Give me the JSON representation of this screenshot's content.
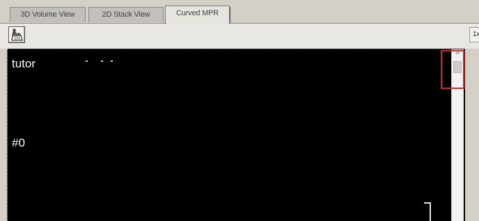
{
  "tabs": [
    {
      "label": "3D Volume View",
      "active": false
    },
    {
      "label": "2D Stack View",
      "active": false
    },
    {
      "label": "Curved MPR",
      "active": true
    }
  ],
  "toolbar": {
    "tool_icon": "brush-icon",
    "zoom_label": "1x"
  },
  "viewport": {
    "top_left_label": "tutor",
    "slice_label": "#0"
  },
  "scrollbar": {
    "up_arrow": "^"
  },
  "colors": {
    "viewport_background": "#000000",
    "overlay_text": "#ffffff",
    "highlight_box": "#d22a2a",
    "tab_active_bg": "#e7e5e0",
    "tab_inactive_bg": "#c2c0ba"
  }
}
